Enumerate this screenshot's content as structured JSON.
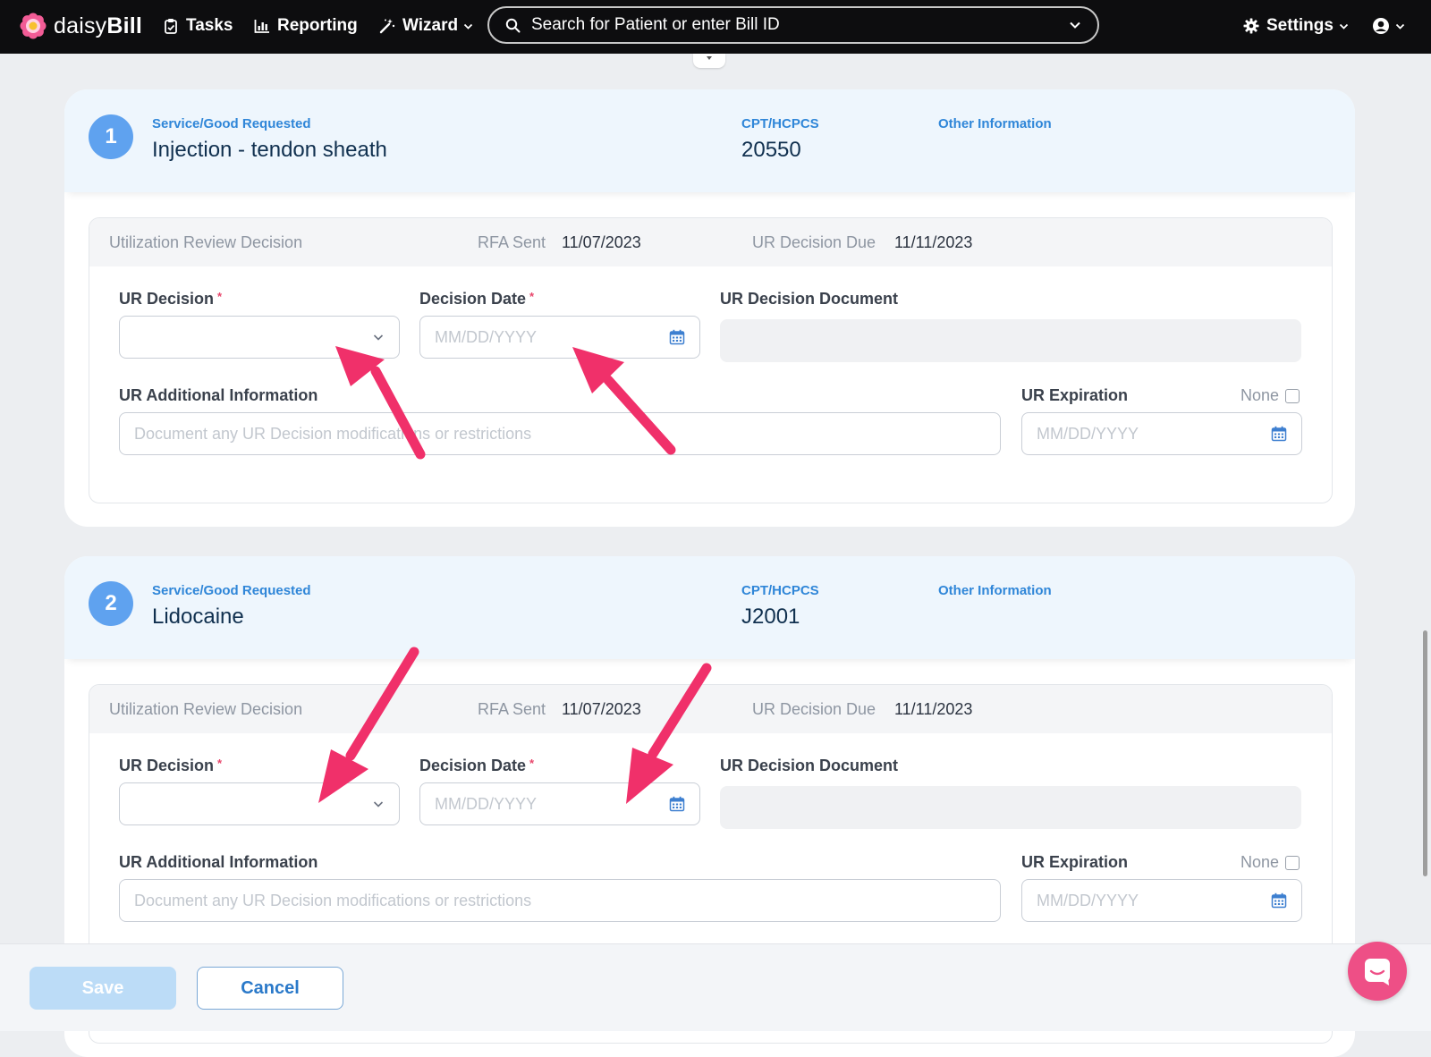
{
  "nav": {
    "logo_text_light": "daisy",
    "logo_text_bold": "Bill",
    "tasks_label": "Tasks",
    "reporting_label": "Reporting",
    "wizard_label": "Wizard",
    "search_placeholder": "Search for Patient or enter Bill ID",
    "settings_label": "Settings"
  },
  "requests": [
    {
      "number": "1",
      "service_label": "Service/Good Requested",
      "service_value": "Injection - tendon sheath",
      "cpt_label": "CPT/HCPCS",
      "cpt_value": "20550",
      "other_label": "Other Information",
      "ur": {
        "title": "Utilization Review Decision",
        "rfa_sent_label": "RFA Sent",
        "rfa_sent_value": "11/07/2023",
        "due_label": "UR Decision Due",
        "due_value": "11/11/2023",
        "decision_label": "UR Decision",
        "decision_date_label": "Decision Date",
        "date_placeholder": "MM/DD/YYYY",
        "document_label": "UR Decision Document",
        "additional_label": "UR Additional Information",
        "additional_placeholder": "Document any UR Decision modifications or restrictions",
        "expiration_label": "UR Expiration",
        "none_label": "None",
        "expiration_placeholder": "MM/DD/YYYY"
      }
    },
    {
      "number": "2",
      "service_label": "Service/Good Requested",
      "service_value": "Lidocaine",
      "cpt_label": "CPT/HCPCS",
      "cpt_value": "J2001",
      "other_label": "Other Information",
      "ur": {
        "title": "Utilization Review Decision",
        "rfa_sent_label": "RFA Sent",
        "rfa_sent_value": "11/07/2023",
        "due_label": "UR Decision Due",
        "due_value": "11/11/2023",
        "decision_label": "UR Decision",
        "decision_date_label": "Decision Date",
        "date_placeholder": "MM/DD/YYYY",
        "document_label": "UR Decision Document",
        "additional_label": "UR Additional Information",
        "additional_placeholder": "Document any UR Decision modifications or restrictions",
        "expiration_label": "UR Expiration",
        "none_label": "None",
        "expiration_placeholder": "MM/DD/YYYY"
      }
    }
  ],
  "footer": {
    "save_label": "Save",
    "cancel_label": "Cancel"
  },
  "colors": {
    "accent_blue": "#2f86d8",
    "step_circle": "#5fa2ef",
    "annotation_arrow": "#f0306a",
    "chat_bubble": "#ee4f86",
    "nav_background": "#0d0d0f"
  },
  "icons": {
    "tasks": "clipboard-check-icon",
    "reporting": "bar-chart-icon",
    "wizard": "magic-wand-icon",
    "search": "search-icon",
    "settings": "gear-icon",
    "account": "user-circle-icon",
    "calendar": "calendar-icon",
    "chat": "chat-icon"
  }
}
